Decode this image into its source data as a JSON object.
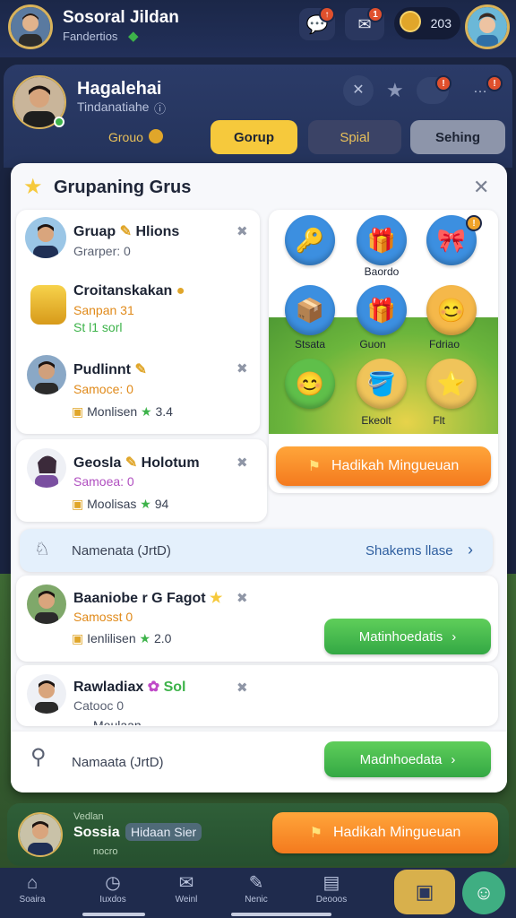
{
  "topbar": {
    "title": "Sosoral Jildan",
    "subtitle": "Fandertios",
    "notif_badge_1": "↑",
    "notif_badge_2": "1",
    "coins_value": "203"
  },
  "profile": {
    "name": "Hagalehai",
    "subtitle": "Tindanatiahe",
    "group_label": "Grouo",
    "tabs": [
      "Gorup",
      "Spial",
      "Sehing"
    ]
  },
  "panel": {
    "title": "Grupaning Grus",
    "rows": [
      {
        "name": "Gruap",
        "tag": "Hlions",
        "sub": "Grarper: 0",
        "meta": ""
      },
      {
        "name": "Croitanskakan",
        "tag": "",
        "sub": "Sanpan 31",
        "meta": "St l1 sorl"
      },
      {
        "name": "Pudlinnt",
        "tag": "",
        "sub": "Samoce: 0",
        "meta": "Monlisen",
        "score": "3.4"
      },
      {
        "name": "Geosla",
        "tag": "Holotum",
        "sub": "Samoea: 0",
        "meta": "Moolisas",
        "score": "94"
      },
      {
        "name": "Baaniobe r G Fagot",
        "tag": "",
        "sub": "Samosst 0",
        "meta": "Ienlilisen",
        "score": "2.0"
      },
      {
        "name": "Rawladiax",
        "tag": "Sol",
        "sub": "Catooc 0",
        "meta": "Meulaan"
      }
    ],
    "notice": {
      "label": "Namenata (JrtD)",
      "action": "Shakems llase"
    },
    "green_btn_1": "Matinhoedatis",
    "green_btn_2": "Madnhoedata",
    "footer_label": "Namaata (JrtD)",
    "gifts": {
      "labels": [
        "Baordo",
        "Stsata",
        "Guon",
        "Fdriao",
        "Ekeolt",
        "Flt"
      ],
      "button": "Hadikah Mingueuan"
    }
  },
  "bottom_card": {
    "top": "Vedlan",
    "name": "Sossia",
    "tag": "Hidaan Sier",
    "sub": "nocro",
    "button": "Hadikah Mingueuan"
  },
  "nav": {
    "items": [
      "Soaira",
      "Iuxdos",
      "Weinl",
      "Nenic",
      "Deooos"
    ]
  },
  "colors": {
    "accent_yellow": "#f6c93c",
    "green": "#3db34a",
    "orange": "#f58a23",
    "navy": "#1b2748"
  }
}
